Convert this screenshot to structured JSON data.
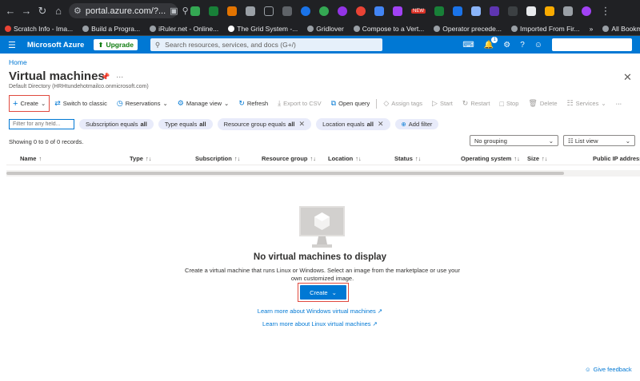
{
  "browser": {
    "url": "portal.azure.com/?...",
    "bookmarks": [
      {
        "label": "Scratch Info - Ima..."
      },
      {
        "label": "Build a Progra..."
      },
      {
        "label": "iRuler.net - Online..."
      },
      {
        "label": "The Grid System -..."
      },
      {
        "label": "Gridlover"
      },
      {
        "label": "Compose to a Vert..."
      },
      {
        "label": "Operator precede..."
      },
      {
        "label": "Imported From Fir..."
      }
    ],
    "all_bookmarks": "All Bookmarks",
    "badge_new": "NEW"
  },
  "azure": {
    "brand": "Microsoft Azure",
    "upgrade": "Upgrade",
    "search_placeholder": "Search resources, services, and docs (G+/)",
    "notification_count": "1"
  },
  "page": {
    "breadcrumb": "Home",
    "title": "Virtual machines",
    "subtitle": "Default Directory (HRHtundehotmailco.onmicrosoft.com)"
  },
  "toolbar": {
    "create": "Create",
    "switch_classic": "Switch to classic",
    "reservations": "Reservations",
    "manage_view": "Manage view",
    "refresh": "Refresh",
    "export_csv": "Export to CSV",
    "open_query": "Open query",
    "assign_tags": "Assign tags",
    "start": "Start",
    "restart": "Restart",
    "stop": "Stop",
    "delete": "Delete",
    "services": "Services"
  },
  "filters": {
    "placeholder": "Filter for any field...",
    "pills": [
      {
        "key": "Subscription equals",
        "val": "all"
      },
      {
        "key": "Type equals",
        "val": "all"
      },
      {
        "key": "Resource group equals",
        "val": "all"
      },
      {
        "key": "Location equals",
        "val": "all"
      }
    ],
    "add_filter": "Add filter"
  },
  "records": "Showing 0 to 0 of 0 records.",
  "grouping": "No grouping",
  "listview": "List view",
  "columns": [
    "Name",
    "Type",
    "Subscription",
    "Resource group",
    "Location",
    "Status",
    "Operating system",
    "Size",
    "Public IP address"
  ],
  "empty": {
    "title": "No virtual machines to display",
    "desc": "Create a virtual machine that runs Linux or Windows. Select an image from the marketplace or use your own customized image.",
    "create": "Create",
    "learn_windows": "Learn more about Windows virtual machines",
    "learn_linux": "Learn more about Linux virtual machines"
  },
  "feedback": "Give feedback",
  "colors": {
    "azure_blue": "#0078d4",
    "chrome_dark": "#202124",
    "highlight": "#e04a3f"
  }
}
